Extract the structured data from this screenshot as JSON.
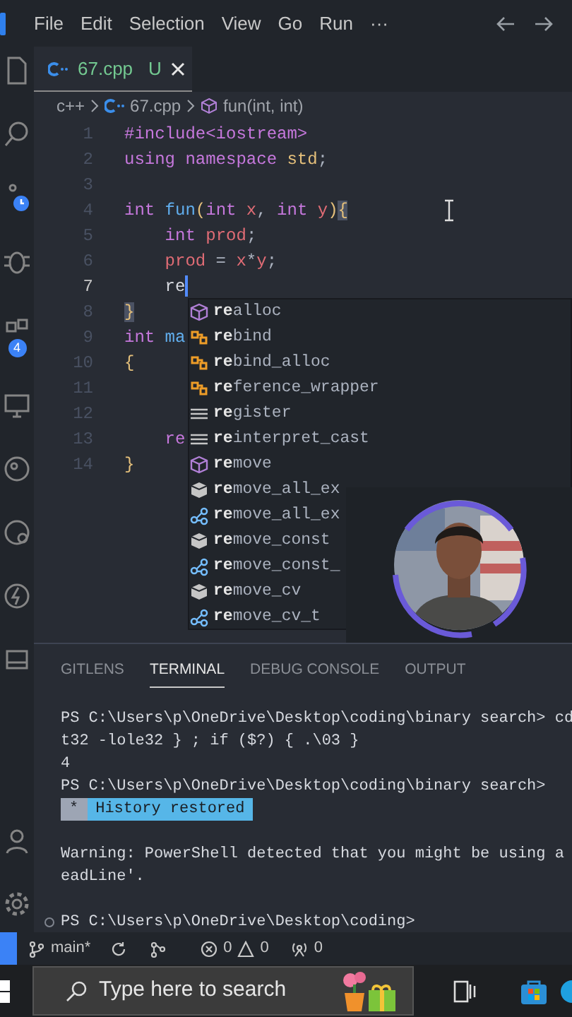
{
  "menu_bar": {
    "items": [
      "File",
      "Edit",
      "Selection",
      "View",
      "Go",
      "Run",
      "···"
    ]
  },
  "activity_bar": {
    "extensions_badge": "4"
  },
  "tab": {
    "label": "67.cpp",
    "status": "U"
  },
  "breadcrumb": [
    {
      "label": "c++",
      "kind": "folder"
    },
    {
      "label": "67.cpp",
      "kind": "file"
    },
    {
      "label": "fun(int, int)",
      "kind": "function"
    }
  ],
  "editor": {
    "lines": [
      {
        "number": "1",
        "active": false,
        "tokens": [
          {
            "t": "#include",
            "kind": "keyword"
          },
          {
            "t": "<iostream>",
            "kind": "keyword"
          }
        ]
      },
      {
        "number": "2",
        "active": false,
        "tokens": [
          {
            "t": "using namespace",
            "kind": "keyword"
          },
          {
            "t": " std",
            "kind": "namespace"
          },
          {
            "t": ";",
            "kind": "punct"
          }
        ]
      },
      {
        "number": "3",
        "active": false
      },
      {
        "number": "4",
        "active": false,
        "tokens": [
          {
            "t": "int",
            "kind": "keyword"
          },
          {
            "t": " fun",
            "kind": "function"
          },
          {
            "t": "(",
            "kind": "paren"
          },
          {
            "t": "int",
            "kind": "keyword"
          },
          {
            "t": " x",
            "kind": "variable"
          },
          {
            "t": ", ",
            "kind": "punct"
          },
          {
            "t": "int",
            "kind": "keyword"
          },
          {
            "t": " y",
            "kind": "variable"
          },
          {
            "t": ")",
            "kind": "paren"
          },
          {
            "t": "{",
            "kind": "match"
          }
        ]
      },
      {
        "number": "5",
        "active": false,
        "tokens": [
          {
            "t": "    int",
            "kind": "keyword"
          },
          {
            "t": " prod",
            "kind": "variable"
          },
          {
            "t": ";",
            "kind": "punct"
          }
        ]
      },
      {
        "number": "6",
        "active": false,
        "tokens": [
          {
            "t": "    prod",
            "kind": "variable"
          },
          {
            "t": " = ",
            "kind": "punct"
          },
          {
            "t": "x",
            "kind": "variable"
          },
          {
            "t": "*",
            "kind": "punct"
          },
          {
            "t": "y",
            "kind": "variable"
          },
          {
            "t": ";",
            "kind": "punct"
          }
        ]
      },
      {
        "number": "7",
        "active": true,
        "tokens": [
          {
            "t": "    re",
            "kind": "plain"
          }
        ]
      },
      {
        "number": "8",
        "active": false,
        "tokens": [
          {
            "t": "}",
            "kind": "match"
          }
        ]
      },
      {
        "number": "9",
        "active": false,
        "tokens": [
          {
            "t": "int",
            "kind": "keyword"
          },
          {
            "t": " ma",
            "kind": "function"
          }
        ]
      },
      {
        "number": "10",
        "active": false,
        "tokens": [
          {
            "t": "{",
            "kind": "paren"
          }
        ]
      },
      {
        "number": "11",
        "active": false
      },
      {
        "number": "12",
        "active": false
      },
      {
        "number": "13",
        "active": false,
        "tokens": [
          {
            "t": "    re",
            "kind": "keyword"
          }
        ]
      },
      {
        "number": "14",
        "active": false,
        "tokens": [
          {
            "t": "}",
            "kind": "paren"
          }
        ]
      }
    ]
  },
  "suggestions": [
    {
      "label": "**re**alloc",
      "kind": "function"
    },
    {
      "label": "**re**bind",
      "kind": "class"
    },
    {
      "label": "**re**bind_alloc",
      "kind": "class"
    },
    {
      "label": "**re**ference_wrapper",
      "kind": "class"
    },
    {
      "label": "**re**gister",
      "kind": "keyword"
    },
    {
      "label": "**re**interpret_cast",
      "kind": "keyword"
    },
    {
      "label": "**re**move",
      "kind": "function"
    },
    {
      "label": "**re**move_all_ex",
      "kind": "struct"
    },
    {
      "label": "**re**move_all_ex",
      "kind": "reference"
    },
    {
      "label": "**re**move_const",
      "kind": "struct"
    },
    {
      "label": "**re**move_const_",
      "kind": "reference"
    },
    {
      "label": "**re**move_cv",
      "kind": "struct"
    },
    {
      "label": "**re**move_cv_t",
      "kind": "reference"
    }
  ],
  "panel": {
    "tabs": [
      {
        "label": "GITLENS",
        "selected": false
      },
      {
        "label": "TERMINAL",
        "selected": true
      },
      {
        "label": "DEBUG CONSOLE",
        "selected": false
      },
      {
        "label": "OUTPUT",
        "selected": false
      }
    ],
    "terminal_lines": [
      {
        "kind": "text",
        "text": "PS C:\\Users\\p\\OneDrive\\Desktop\\coding\\binary search> cd"
      },
      {
        "kind": "text",
        "text": "t32 -lole32 } ; if ($?) { .\\03 }"
      },
      {
        "kind": "text",
        "text": "4"
      },
      {
        "kind": "text",
        "text": "PS C:\\Users\\p\\OneDrive\\Desktop\\coding\\binary search>"
      },
      {
        "kind": "notice",
        "mark": "*",
        "text": "History restored"
      },
      {
        "kind": "blank"
      },
      {
        "kind": "text",
        "text": "Warning: PowerShell detected that you might be using a"
      },
      {
        "kind": "text",
        "text": "eadLine'."
      },
      {
        "kind": "blank"
      },
      {
        "kind": "prompt",
        "text": "PS C:\\Users\\p\\OneDrive\\Desktop\\coding>"
      }
    ]
  },
  "status_bar": {
    "branch": "main*",
    "errors": "0",
    "warnings": "0",
    "ports": "0"
  },
  "taskbar": {
    "search_placeholder": "Type here to search"
  }
}
